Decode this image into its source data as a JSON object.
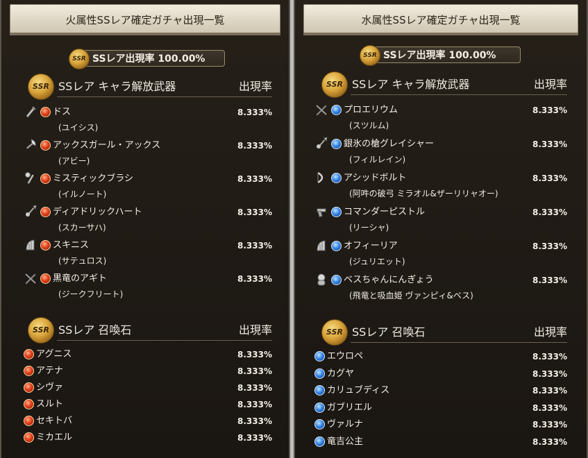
{
  "left": {
    "header": "火属性SSレア確定ガチャ出現一覧",
    "rate_pill": "SSレア出現率 100.00%",
    "badge_text": "SSR",
    "weapons_title": "SSレア キャラ解放武器",
    "weapons_rate_label": "出現率",
    "weapons": [
      {
        "name": "ドス",
        "character": "(ユイシス)",
        "rate": "8.333%",
        "icon": "dagger-icon"
      },
      {
        "name": "アックスガール・アックス",
        "character": "(アビー)",
        "rate": "8.333%",
        "icon": "axe-icon"
      },
      {
        "name": "ミスティックブラシ",
        "character": "(イルノート)",
        "rate": "8.333%",
        "icon": "staff-icon"
      },
      {
        "name": "ディアドリックハート",
        "character": "(スカーサハ)",
        "rate": "8.333%",
        "icon": "spear-icon"
      },
      {
        "name": "スキニス",
        "character": "(サテュロス)",
        "rate": "8.333%",
        "icon": "harp-icon"
      },
      {
        "name": "黒竜のアギト",
        "character": "(ジークフリート)",
        "rate": "8.333%",
        "icon": "sword-icon"
      }
    ],
    "summons_title": "SSレア 召喚石",
    "summons_rate_label": "出現率",
    "summons": [
      {
        "name": "アグニス",
        "rate": "8.333%"
      },
      {
        "name": "アテナ",
        "rate": "8.333%"
      },
      {
        "name": "シヴァ",
        "rate": "8.333%"
      },
      {
        "name": "スルト",
        "rate": "8.333%"
      },
      {
        "name": "セキトバ",
        "rate": "8.333%"
      },
      {
        "name": "ミカエル",
        "rate": "8.333%"
      }
    ]
  },
  "right": {
    "header": "水属性SSレア確定ガチャ出現一覧",
    "rate_pill": "SSレア出現率 100.00%",
    "badge_text": "SSR",
    "weapons_title": "SSレア キャラ解放武器",
    "weapons_rate_label": "出現率",
    "weapons": [
      {
        "name": "プロエリウム",
        "character": "(スツルム)",
        "rate": "8.333%",
        "icon": "sword-icon"
      },
      {
        "name": "銀氷の槍グレイシャー",
        "character": "(フィルレイン)",
        "rate": "8.333%",
        "icon": "spear-icon"
      },
      {
        "name": "アシッドボルト",
        "character": "(阿吽の破弓 ミラオル&ザーリリャオー)",
        "rate": "8.333%",
        "icon": "bow-icon"
      },
      {
        "name": "コマンダーピストル",
        "character": "(リーシャ)",
        "rate": "8.333%",
        "icon": "gun-icon"
      },
      {
        "name": "オフィーリア",
        "character": "(ジュリエット)",
        "rate": "8.333%",
        "icon": "harp-icon"
      },
      {
        "name": "ベスちゃんにんぎょう",
        "character": "(飛竜と吸血姫 ヴァンピィ&ベス)",
        "rate": "8.333%",
        "icon": "doll-icon"
      }
    ],
    "summons_title": "SSレア 召喚石",
    "summons_rate_label": "出現率",
    "summons": [
      {
        "name": "エウロペ",
        "rate": "8.333%"
      },
      {
        "name": "カグヤ",
        "rate": "8.333%"
      },
      {
        "name": "カリュブディス",
        "rate": "8.333%"
      },
      {
        "name": "ガブリエル",
        "rate": "8.333%"
      },
      {
        "name": "ヴァルナ",
        "rate": "8.333%"
      },
      {
        "name": "竜吉公主",
        "rate": "8.333%"
      }
    ]
  },
  "colors": {
    "fire": "#e0401a",
    "water": "#2f7ee0",
    "gold": "#d8a33a"
  }
}
